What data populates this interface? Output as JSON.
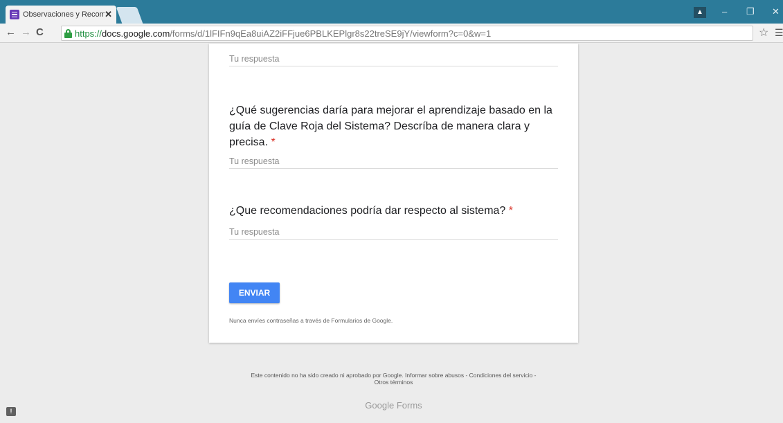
{
  "browser": {
    "tab_title": "Observaciones y Recomen",
    "tab_close": "✕",
    "url_scheme": "https://",
    "url_host": "docs.google.com",
    "url_path": "/forms/d/1lFIFn9qEa8uiAZ2iFFjue6PBLKEPlgr8s22treSE9jY/viewform?c=0&w=1"
  },
  "form": {
    "answer_placeholder": "Tu respuesta",
    "questions": [
      {
        "text": "¿Qué sugerencias daría para mejorar el aprendizaje basado en la guía de Clave Roja del Sistema? Descríba de manera clara y precisa.",
        "required_mark": "*"
      },
      {
        "text": "¿Que recomendaciones podría dar respecto al sistema?",
        "required_mark": "*"
      }
    ],
    "submit_label": "ENVIAR",
    "password_note": "Nunca envíes contraseñas a través de Formularios de Google."
  },
  "footer": {
    "disclaimer_line1": "Este contenido no ha sido creado ni aprobado por Google. Informar sobre abusos - Condiciones del servicio -",
    "disclaimer_line2": "Otros términos",
    "brand_google": "Google",
    "brand_forms": "Forms"
  },
  "colors": {
    "titlebar": "#2c7b9a",
    "submit_button": "#4285f4",
    "required_asterisk": "#d93025"
  }
}
